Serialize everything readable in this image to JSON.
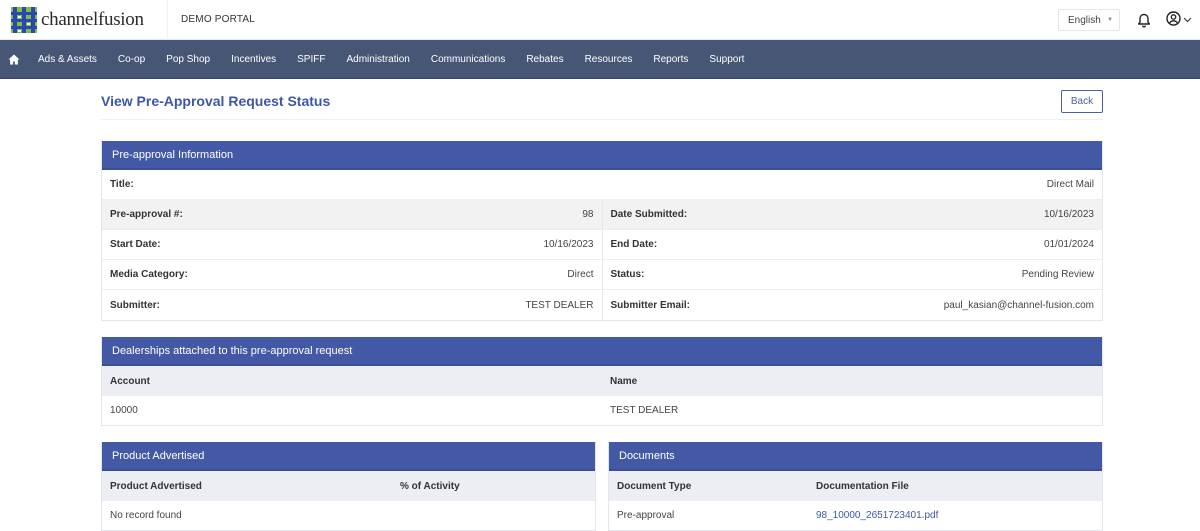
{
  "app": {
    "brand": "channelfusion",
    "portal_name": "DEMO PORTAL"
  },
  "header": {
    "language": "English",
    "icons": [
      "bell-icon",
      "user-circle-icon",
      "chevron-down-icon"
    ]
  },
  "nav": {
    "home_icon": "home-icon",
    "items": [
      {
        "label": "Ads & Assets"
      },
      {
        "label": "Co-op"
      },
      {
        "label": "Pop Shop"
      },
      {
        "label": "Incentives"
      },
      {
        "label": "SPIFF"
      },
      {
        "label": "Administration"
      },
      {
        "label": "Communications"
      },
      {
        "label": "Rebates"
      },
      {
        "label": "Resources"
      },
      {
        "label": "Reports"
      },
      {
        "label": "Support"
      }
    ]
  },
  "page": {
    "title": "View Pre-Approval Request Status",
    "back_label": "Back"
  },
  "info": {
    "heading": "Pre-approval Information",
    "title_label": "Title:",
    "title_value": "Direct Mail",
    "rows": [
      {
        "l_label": "Pre-approval #:",
        "l_value": "98",
        "r_label": "Date Submitted:",
        "r_value": "10/16/2023"
      },
      {
        "l_label": "Start Date:",
        "l_value": "10/16/2023",
        "r_label": "End Date:",
        "r_value": "01/01/2024"
      },
      {
        "l_label": "Media Category:",
        "l_value": "Direct",
        "r_label": "Status:",
        "r_value": "Pending Review"
      },
      {
        "l_label": "Submitter:",
        "l_value": "TEST DEALER",
        "r_label": "Submitter Email:",
        "r_value": "paul_kasian@channel-fusion.com"
      }
    ]
  },
  "dealerships": {
    "heading": "Dealerships attached to this pre-approval request",
    "columns": [
      "Account",
      "Name"
    ],
    "rows": [
      {
        "account": "10000",
        "name": "TEST DEALER"
      }
    ]
  },
  "products": {
    "heading": "Product Advertised",
    "columns": [
      "Product Advertised",
      "% of Activity"
    ],
    "empty_message": "No record found"
  },
  "documents": {
    "heading": "Documents",
    "columns": [
      "Document Type",
      "Documentation File"
    ],
    "rows": [
      {
        "type": "Pre-approval",
        "file": "98_10000_2651723401.pdf"
      }
    ]
  },
  "colors": {
    "nav_bg": "#485676",
    "panel_header": "#4459a6",
    "title_blue": "#3d57a6",
    "logo_blue": "#2f46b0",
    "logo_green": "#7cc242"
  }
}
